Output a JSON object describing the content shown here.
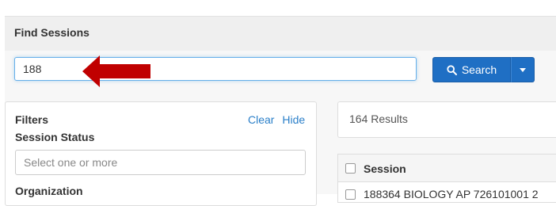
{
  "header": {
    "title": "Find Sessions"
  },
  "search": {
    "value": "188",
    "button_label": "Search"
  },
  "filters": {
    "title": "Filters",
    "clear_label": "Clear",
    "hide_label": "Hide",
    "session_status_label": "Session Status",
    "session_status_placeholder": "Select one or more",
    "organization_label": "Organization"
  },
  "results": {
    "count_text": "164 Results",
    "columns": [
      "Session"
    ],
    "rows": [
      {
        "session": "188364 BIOLOGY AP 726101001 2"
      }
    ]
  },
  "colors": {
    "primary_button": "#1f6fc4",
    "link": "#2a7fc9",
    "arrow": "#c00000"
  },
  "icons": {
    "search": "search-icon",
    "caret": "chevron-down-icon",
    "arrow": "arrow-left-icon"
  }
}
